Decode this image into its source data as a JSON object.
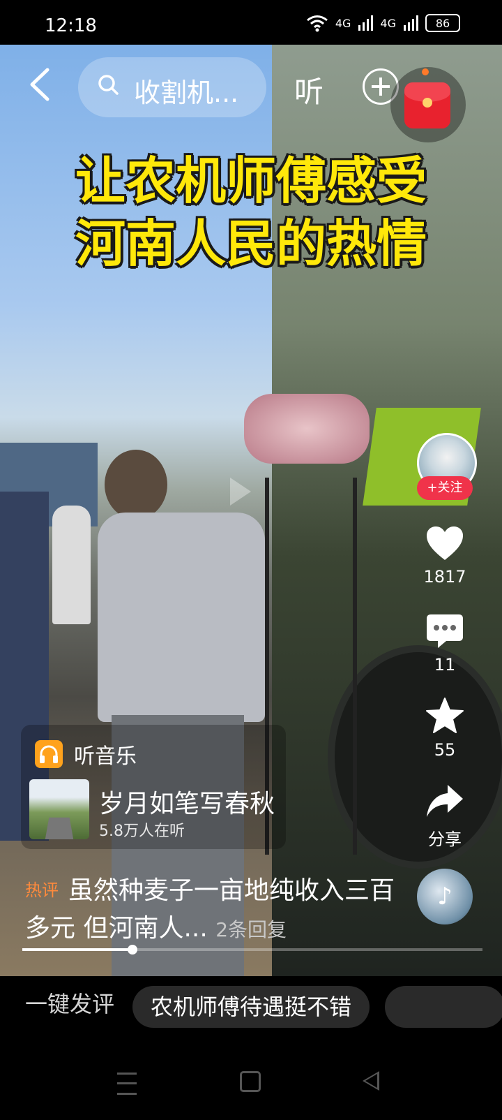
{
  "status_bar": {
    "time": "12:18",
    "network_1": "4G",
    "network_2": "4G",
    "battery": "86"
  },
  "top_bar": {
    "search_text": "收割机...",
    "listen_label": "听"
  },
  "video": {
    "caption_line1": "让农机师傅感受",
    "caption_line2": "河南人民的热情"
  },
  "right_rail": {
    "follow_label": "+关注",
    "likes": "1817",
    "comments": "11",
    "favorites": "55",
    "share_label": "分享"
  },
  "music": {
    "section_label": "听音乐",
    "song_title": "岁月如笔写春秋",
    "listeners": "5.8万人在听"
  },
  "hot_comment": {
    "tag": "热评",
    "text": "虽然种麦子一亩地纯收入三百多元 但河南人...",
    "replies": "2条回复"
  },
  "playback": {
    "progress_fraction": 0.24
  },
  "bottom_bar": {
    "quick_comment_label": "一键发评",
    "chip_1": "农机师傅待遇挺不错"
  },
  "colors": {
    "caption_yellow": "#ffe80a",
    "follow_red": "#f0334a",
    "hot_orange": "#ff8a3c"
  }
}
